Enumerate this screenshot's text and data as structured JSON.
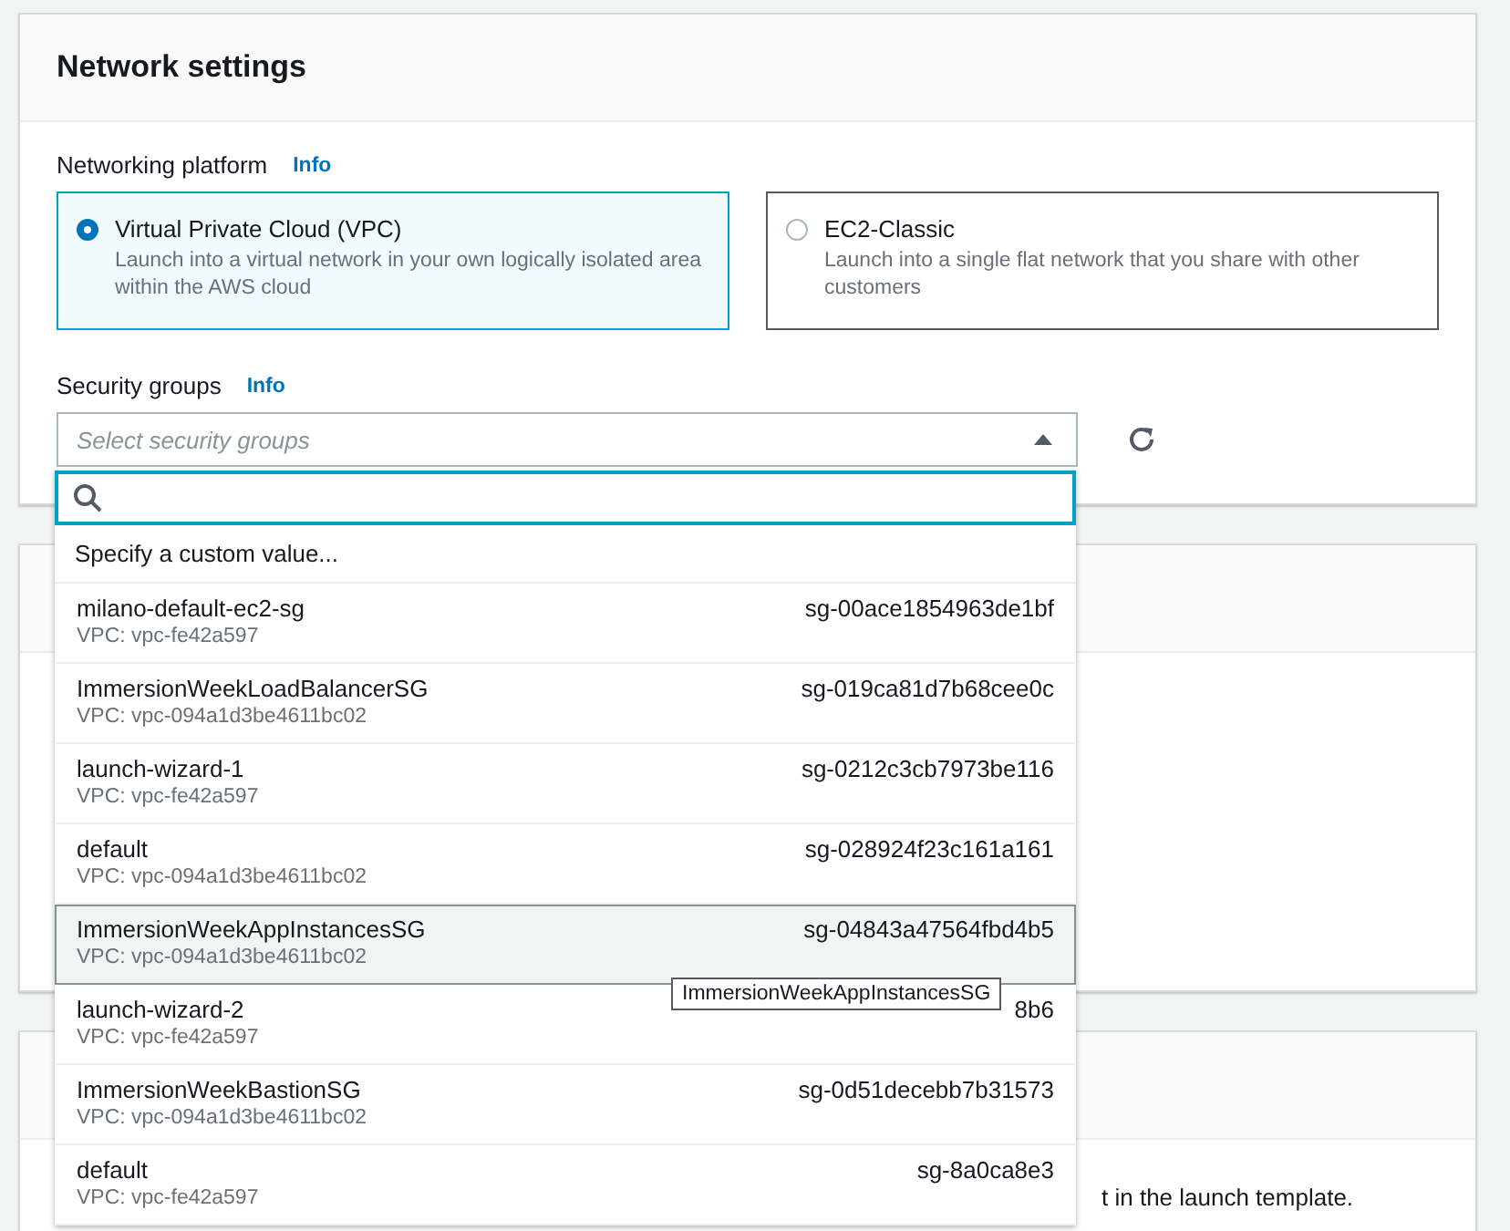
{
  "section": {
    "title": "Network settings"
  },
  "platform": {
    "label": "Networking platform",
    "info": "Info",
    "options": [
      {
        "title": "Virtual Private Cloud (VPC)",
        "description": "Launch into a virtual network in your own logically isolated area within the AWS cloud",
        "selected": true
      },
      {
        "title": "EC2-Classic",
        "description": "Launch into a single flat network that you share with other customers",
        "selected": false
      }
    ]
  },
  "security_groups": {
    "label": "Security groups",
    "info": "Info",
    "placeholder": "Select security groups",
    "expanded": true,
    "custom_value": "Specify a custom value...",
    "options": [
      {
        "name": "milano-default-ec2-sg",
        "vpc": "VPC: vpc-fe42a597",
        "id": "sg-00ace1854963de1bf",
        "highlighted": false
      },
      {
        "name": "ImmersionWeekLoadBalancerSG",
        "vpc": "VPC: vpc-094a1d3be4611bc02",
        "id": "sg-019ca81d7b68cee0c",
        "highlighted": false
      },
      {
        "name": "launch-wizard-1",
        "vpc": "VPC: vpc-fe42a597",
        "id": "sg-0212c3cb7973be116",
        "highlighted": false
      },
      {
        "name": "default",
        "vpc": "VPC: vpc-094a1d3be4611bc02",
        "id": "sg-028924f23c161a161",
        "highlighted": false
      },
      {
        "name": "ImmersionWeekAppInstancesSG",
        "vpc": "VPC: vpc-094a1d3be4611bc02",
        "id": "sg-04843a47564fbd4b5",
        "highlighted": true
      },
      {
        "name": "launch-wizard-2",
        "vpc": "VPC: vpc-fe42a597",
        "id": "8b6",
        "highlighted": false
      },
      {
        "name": "ImmersionWeekBastionSG",
        "vpc": "VPC: vpc-094a1d3be4611bc02",
        "id": "sg-0d51decebb7b31573",
        "highlighted": false
      },
      {
        "name": "default",
        "vpc": "VPC: vpc-fe42a597",
        "id": "sg-8a0ca8e3",
        "highlighted": false
      }
    ]
  },
  "tooltip": "ImmersionWeekAppInstancesSG",
  "lower_section": {
    "text": "t in the launch template."
  }
}
